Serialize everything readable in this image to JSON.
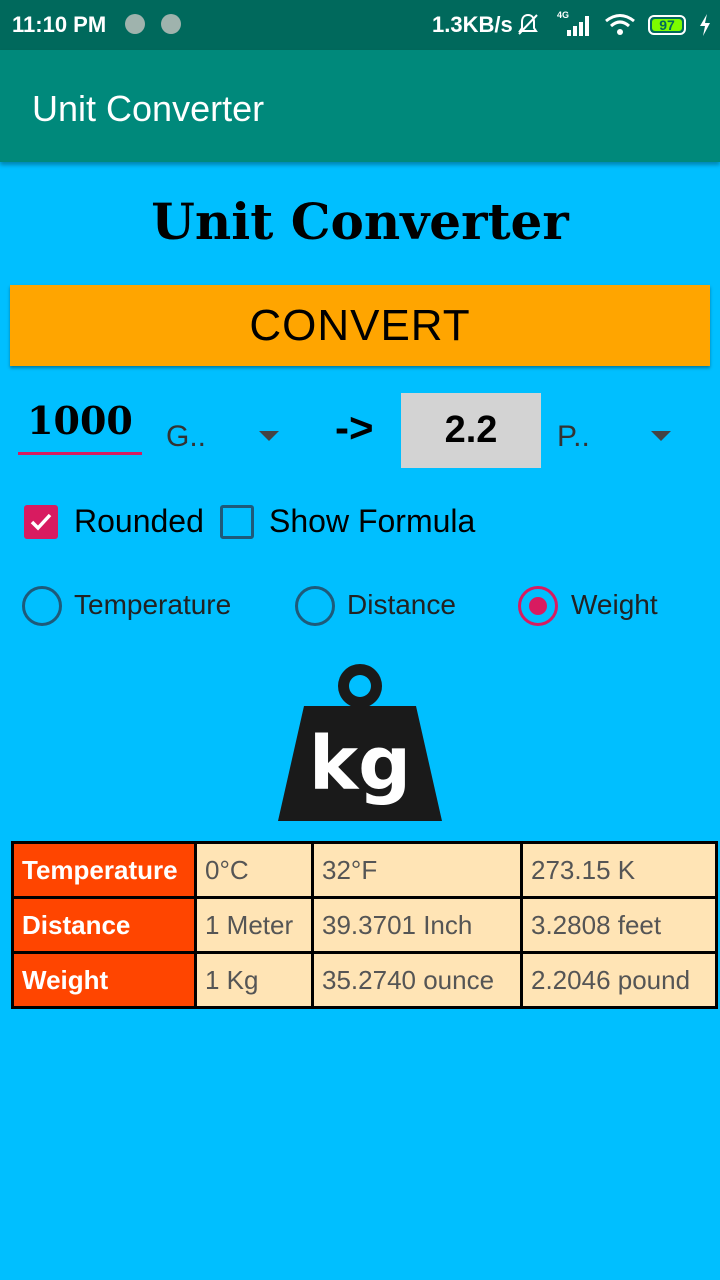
{
  "status_bar": {
    "time": "11:10 PM",
    "net_speed": "1.3KB/s",
    "network_type": "4G",
    "battery": "97"
  },
  "app_bar": {
    "title": "Unit Converter"
  },
  "main": {
    "heading": "Unit Converter",
    "convert_label": "CONVERT",
    "input_value": "1000",
    "from_unit": "G..",
    "arrow": "->",
    "result_value": "2.2",
    "to_unit": "P..",
    "options": {
      "rounded_label": "Rounded",
      "show_formula_label": "Show Formula"
    },
    "radios": {
      "temperature": "Temperature",
      "distance": "Distance",
      "weight": "Weight"
    },
    "image_icon": "kg-weight-icon",
    "icon_text": "kg"
  },
  "table": {
    "rows": [
      {
        "label": "Temperature",
        "cells": [
          "0°C",
          "32°F",
          "273.15 K"
        ]
      },
      {
        "label": "Distance",
        "cells": [
          "1 Meter",
          "39.3701 Inch",
          "3.2808 feet"
        ]
      },
      {
        "label": "Weight",
        "cells": [
          "1 Kg",
          "35.2740 ounce",
          "2.2046 pound"
        ]
      }
    ]
  },
  "colors": {
    "background": "#00BFFF",
    "status_bar": "#00695C",
    "app_bar": "#00897B",
    "convert_button": "#FFA500",
    "accent": "#D81B60",
    "table_header": "#FF4500",
    "table_cell": "#FFE4B5"
  }
}
